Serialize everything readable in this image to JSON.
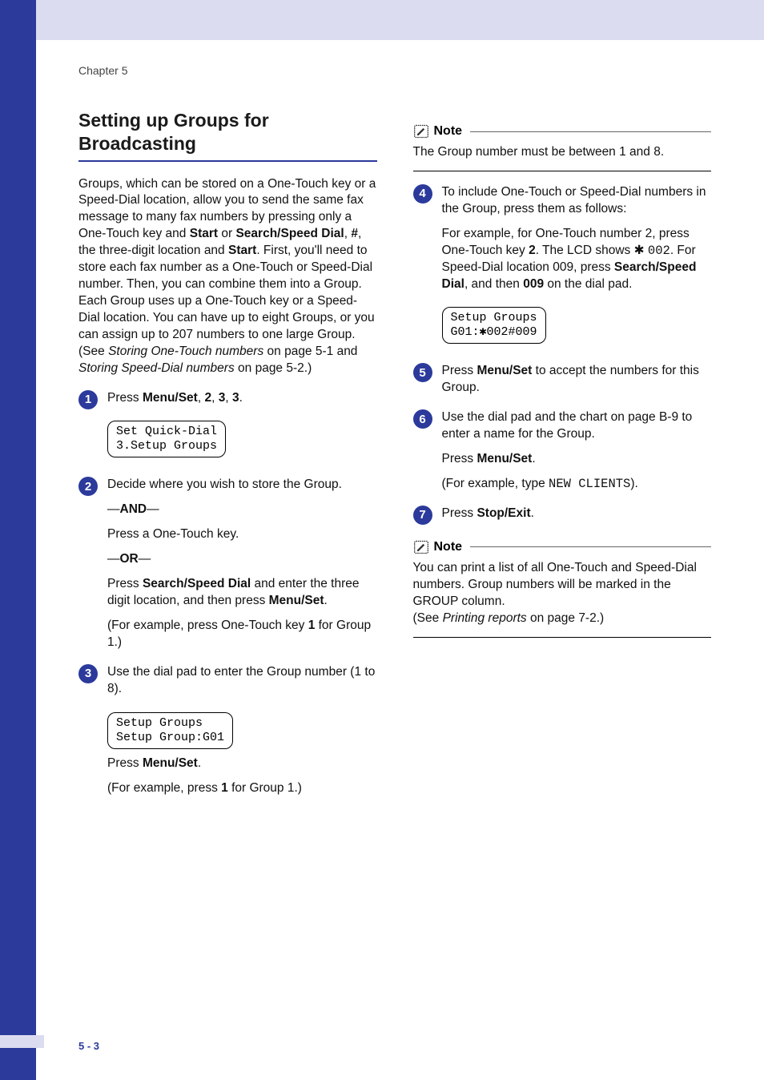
{
  "chapter": "Chapter 5",
  "page_number": "5 - 3",
  "left": {
    "heading": "Setting up Groups for Broadcasting",
    "intro_html": "Groups, which can be stored on a One-Touch key or a Speed-Dial location, allow you to send the same fax message to many fax numbers by pressing only a One-Touch key and <b>Start</b> or <b>Search/Speed Dial</b>, <b>#</b>, the three-digit location and <b>Start</b>. First, you'll need to store each fax number as a One-Touch or Speed-Dial number. Then, you can combine them into a Group. Each Group uses up a One-Touch key or a Speed-Dial location. You can have up to eight Groups, or you can assign up to 207 numbers to one large Group.",
    "intro_see": "(See <i>Storing One-Touch numbers</i> on page 5-1 and <i>Storing Speed-Dial numbers</i> on page 5-2.)",
    "step1_text": "Press <b>Menu/Set</b>, <b>2</b>, <b>3</b>, <b>3</b>.",
    "lcd1": "Set Quick-Dial\n3.Setup Groups",
    "step2_p1": "Decide where you wish to store the Group.",
    "step2_and": "—<b>AND</b>—",
    "step2_p2": "Press a One-Touch key.",
    "step2_or": "—<b>OR</b>—",
    "step2_p3": "Press <b>Search/Speed Dial</b> and enter the three digit location, and then press <b>Menu/Set</b>.",
    "step2_p4": "(For example, press One-Touch key <b>1</b> for Group 1.)",
    "step3_p1": "Use the dial pad to enter the Group number (1 to 8).",
    "lcd3": "Setup Groups\nSetup Group:G01",
    "step3_p2": "Press <b>Menu/Set</b>.",
    "step3_p3": "(For example, press <b>1</b> for Group 1.)"
  },
  "right": {
    "note1_title": "Note",
    "note1_body": "The Group number must be between 1 and 8.",
    "step4_p1": "To include One-Touch or Speed-Dial numbers in the Group, press them as follows:",
    "step4_p2": "For example, for One-Touch number 2, press One-Touch key <b>2</b>. The LCD shows  <span class='star'>✱</span> <span class='mono'>002</span>. For Speed-Dial location 009, press <b>Search/Speed Dial</b>, and then <b>009</b> on the dial pad.",
    "lcd4": "Setup Groups\nG01:✱002#009",
    "step5": "Press <b>Menu/Set</b> to accept the numbers for this Group.",
    "step6_p1": "Use the dial pad and the chart on page B-9 to enter a name for the Group.",
    "step6_p2": "Press <b>Menu/Set</b>.",
    "step6_p3": "(For example, type <span class='mono'>NEW CLIENTS</span>).",
    "step7": "Press <b>Stop/Exit</b>.",
    "note2_title": "Note",
    "note2_body": "You can print a list of all One-Touch and Speed-Dial numbers. Group numbers will be marked in the GROUP column.",
    "note2_see": "(See <i>Printing reports</i> on page 7-2.)"
  }
}
